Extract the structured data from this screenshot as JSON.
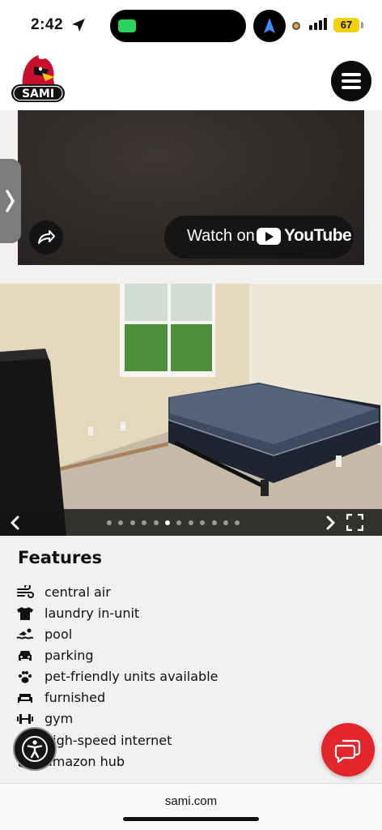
{
  "status_bar": {
    "time": "2:42",
    "battery": "67"
  },
  "header": {
    "logo_text": "SAMI",
    "menu_icon": "hamburger-menu-icon"
  },
  "video": {
    "watch_label": "Watch on",
    "youtube_label": "YouTube",
    "share_icon": "share-icon"
  },
  "gallery": {
    "prev_icon": "chevron-left-icon",
    "next_icon": "chevron-right-icon",
    "fullscreen_icon": "fullscreen-icon",
    "dot_count": 12,
    "active_index": 5
  },
  "features": {
    "title": "Features",
    "items": [
      {
        "label": "central air",
        "icon": "fan-icon"
      },
      {
        "label": "laundry in-unit",
        "icon": "shirt-icon"
      },
      {
        "label": "pool",
        "icon": "swimmer-icon"
      },
      {
        "label": "parking",
        "icon": "car-icon"
      },
      {
        "label": "pet-friendly units available",
        "icon": "paw-icon"
      },
      {
        "label": "furnished",
        "icon": "couch-icon"
      },
      {
        "label": "gym",
        "icon": "dumbbell-icon"
      },
      {
        "label": "high-speed internet",
        "icon": "wifi-icon"
      },
      {
        "label": "amazon hub",
        "icon": "box-icon"
      }
    ]
  },
  "floating": {
    "accessibility_icon": "accessibility-icon",
    "chat_icon": "chat-icon"
  },
  "browser": {
    "url": "sami.com"
  },
  "colors": {
    "brand_red": "#e3262b",
    "dark": "#111111",
    "page_gray": "#f1f1f1"
  }
}
